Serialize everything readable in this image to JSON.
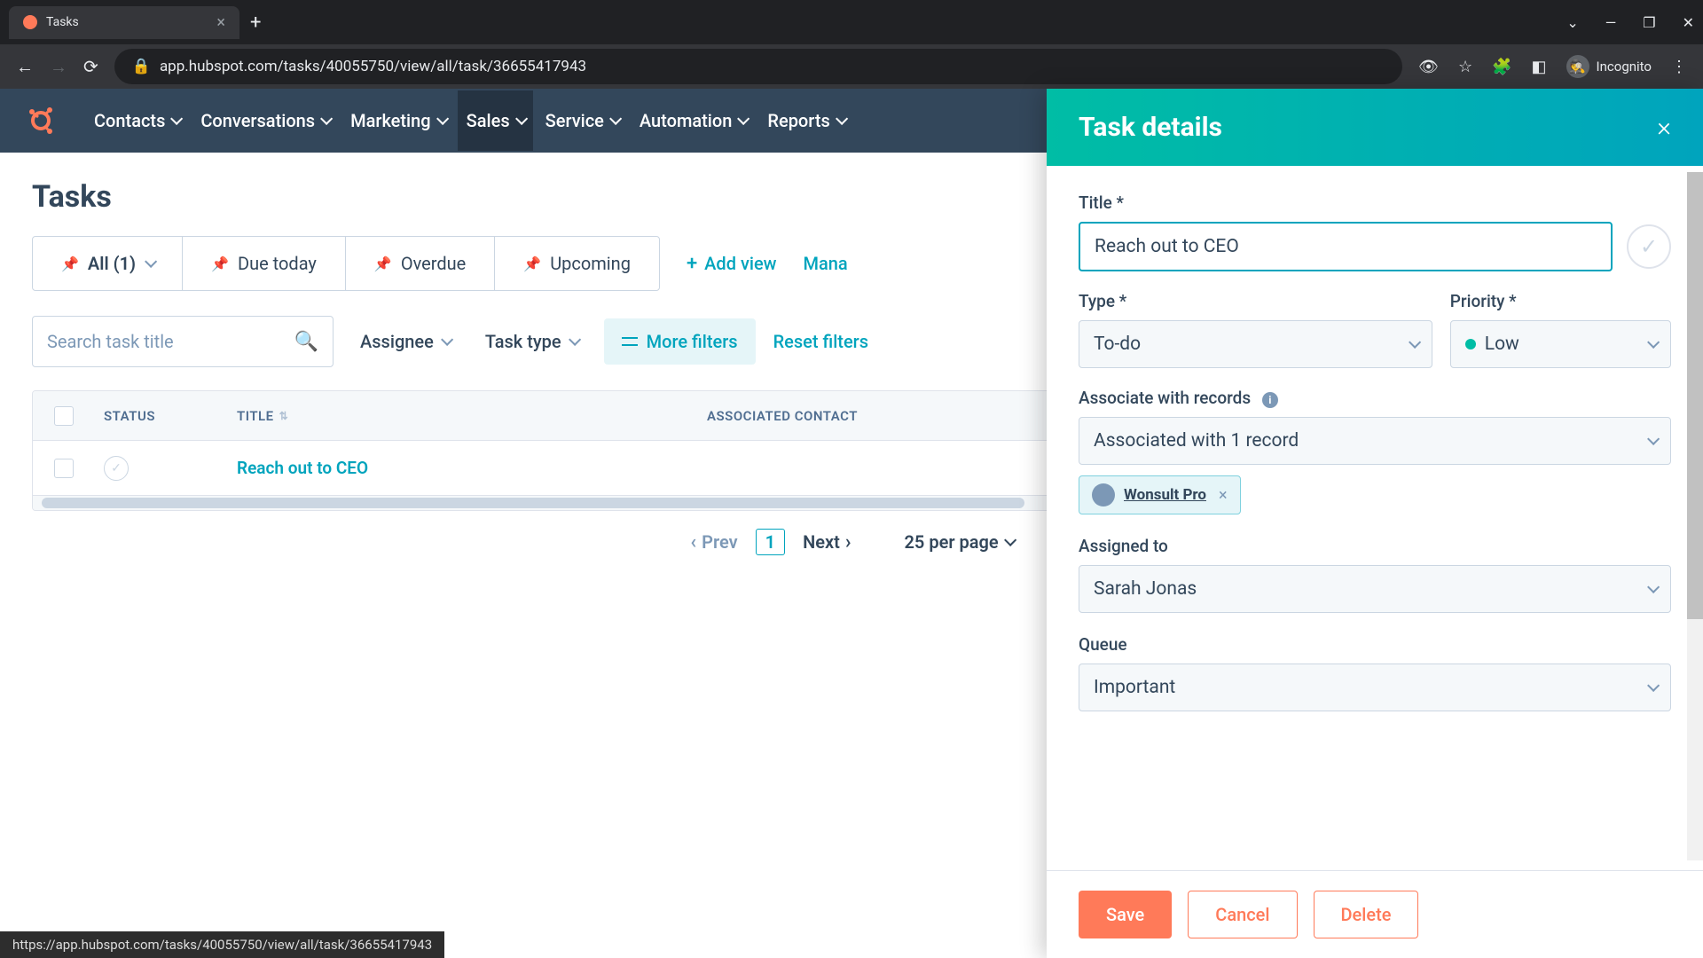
{
  "browser": {
    "tab_title": "Tasks",
    "url_display": "app.hubspot.com/tasks/40055750/view/all/task/36655417943",
    "incognito_label": "Incognito",
    "status_url": "https://app.hubspot.com/tasks/40055750/view/all/task/36655417943"
  },
  "nav": {
    "items": [
      "Contacts",
      "Conversations",
      "Marketing",
      "Sales",
      "Service",
      "Automation",
      "Reports"
    ],
    "active_index": 3
  },
  "page": {
    "title": "Tasks"
  },
  "views": {
    "tabs": [
      {
        "label": "All (1)",
        "has_caret": true
      },
      {
        "label": "Due today",
        "has_caret": false
      },
      {
        "label": "Overdue",
        "has_caret": false
      },
      {
        "label": "Upcoming",
        "has_caret": false
      }
    ],
    "active_index": 0,
    "add_view_label": "Add view",
    "manage_label": "Mana"
  },
  "filters": {
    "search_placeholder": "Search task title",
    "assignee_label": "Assignee",
    "task_type_label": "Task type",
    "more_filters_label": "More filters",
    "reset_label": "Reset filters"
  },
  "table": {
    "columns": {
      "status": "STATUS",
      "title": "TITLE",
      "contact": "ASSOCIATED CONTACT"
    },
    "rows": [
      {
        "title": "Reach out to CEO",
        "contact": ""
      }
    ]
  },
  "pager": {
    "prev": "Prev",
    "next": "Next",
    "current": "1",
    "per_page": "25 per page"
  },
  "panel": {
    "header": "Task details",
    "title_label": "Title *",
    "title_value": "Reach out to CEO",
    "type_label": "Type *",
    "type_value": "To-do",
    "priority_label": "Priority *",
    "priority_value": "Low",
    "associate_label": "Associate with records",
    "associate_value": "Associated with 1 record",
    "chip_label": "Wonsult Pro",
    "assigned_label": "Assigned to",
    "assigned_value": "Sarah Jonas",
    "queue_label": "Queue",
    "queue_value": "Important",
    "save": "Save",
    "cancel": "Cancel",
    "delete": "Delete"
  }
}
